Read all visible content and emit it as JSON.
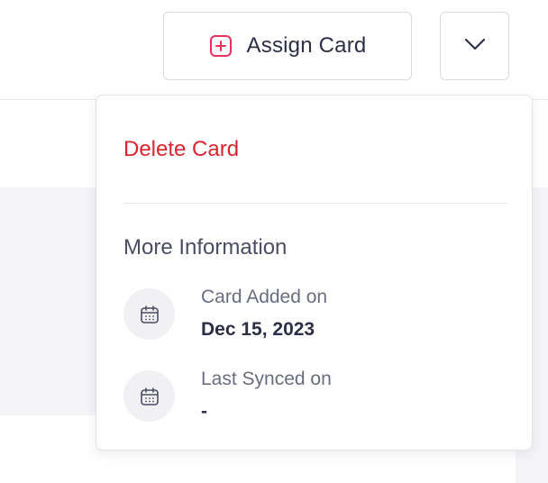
{
  "header": {
    "assign_button": {
      "label": "Assign Card",
      "icon": "plus-square-icon"
    },
    "more_toggle": {
      "icon": "chevron-down-icon"
    }
  },
  "menu": {
    "delete_label": "Delete Card",
    "section_title": "More Information",
    "items": [
      {
        "label": "Card Added on",
        "value": "Dec 15, 2023",
        "icon": "calendar-icon"
      },
      {
        "label": "Last Synced on",
        "value": "-",
        "icon": "calendar-icon"
      }
    ]
  },
  "colors": {
    "accent_red": "#d7262f",
    "icon_pink": "#e8315a",
    "text_dark": "#2d2f45",
    "text_muted": "#6a6c80"
  }
}
